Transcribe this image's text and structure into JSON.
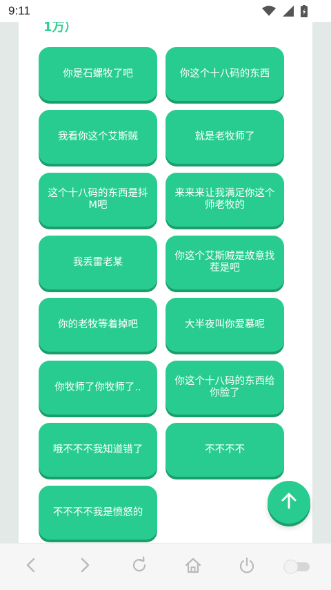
{
  "status_bar": {
    "time": "9:11"
  },
  "header_fragment": "1万）",
  "buttons": [
    "你是石螺牧了吧",
    "你这个十八码的东西",
    "我看你这个艾斯贼",
    "就是老牧师了",
    "这个十八码的东西是抖M吧",
    "来来来让我满足你这个师老牧的",
    "我丢雷老某",
    "你这个艾斯贼是故意找茬是吧",
    "你的老牧等着掉吧",
    "大半夜叫你爱慕呢",
    "你牧师了你牧师了..",
    "你这个十八码的东西给你脸了",
    "哦不不不我知道错了",
    "不不不不",
    "不不不不我是愤怒的"
  ],
  "icons": {
    "wifi": "wifi-icon",
    "signal": "signal-icon",
    "battery": "battery-icon",
    "scroll_top": "arrow-up-icon",
    "back": "chevron-left-icon",
    "forward": "chevron-right-icon",
    "refresh": "refresh-icon",
    "home": "home-icon",
    "power": "power-icon",
    "toggle": "toggle-switch"
  },
  "colors": {
    "accent": "#28cc91",
    "accent_shadow": "#1a9f6c",
    "page_bg": "#e3e9e6",
    "card_bg": "#ffffff",
    "toolbar_bg": "#f6f6f6",
    "toolbar_icon": "#b9b9b9"
  }
}
